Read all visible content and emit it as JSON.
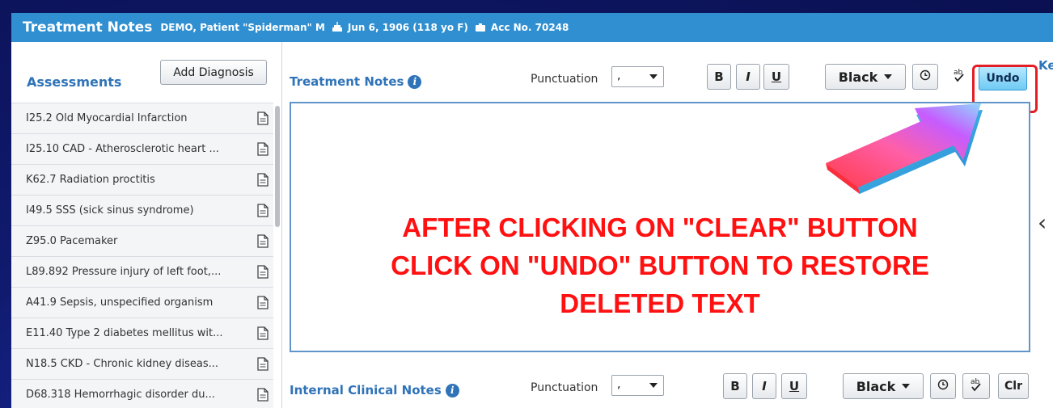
{
  "header": {
    "title": "Treatment Notes",
    "patient": "DEMO, Patient \"Spiderman\" M",
    "dob": "Jun 6, 1906 (118 yo F)",
    "account": "Acc No. 70248"
  },
  "assessments": {
    "title": "Assessments",
    "add_button": "Add Diagnosis",
    "items": [
      "I25.2 Old Myocardial Infarction",
      "I25.10 CAD - Atherosclerotic heart ...",
      "K62.7 Radiation proctitis",
      "I49.5 SSS (sick sinus syndrome)",
      "Z95.0 Pacemaker",
      "L89.892 Pressure injury of left foot,...",
      "A41.9 Sepsis, unspecified organism",
      "E11.40 Type 2 diabetes mellitus wit...",
      "N18.5 CKD - Chronic kidney diseas...",
      "D68.318 Hemorrhagic disorder du..."
    ]
  },
  "treatment_notes": {
    "title": "Treatment Notes",
    "punctuation_label": "Punctuation",
    "punctuation_value": ",",
    "bold": "B",
    "italic": "I",
    "underline": "U",
    "color": "Black",
    "undo": "Undo",
    "cut_off_label": "Ke",
    "instruction_lines": [
      "AFTER CLICKING ON \"CLEAR\" BUTTON",
      "CLICK ON \"UNDO\" BUTTON TO RESTORE",
      "DELETED TEXT"
    ]
  },
  "internal_notes": {
    "title": "Internal Clinical Notes",
    "punctuation_label": "Punctuation",
    "punctuation_value": ",",
    "bold": "B",
    "italic": "I",
    "underline": "U",
    "color": "Black",
    "clear": "Clr"
  },
  "colors": {
    "header_bg": "#2f8fd0",
    "accent_text": "#2f73b8",
    "annotation_red": "#e51e25",
    "undo_bg": "#6fcaf4"
  }
}
